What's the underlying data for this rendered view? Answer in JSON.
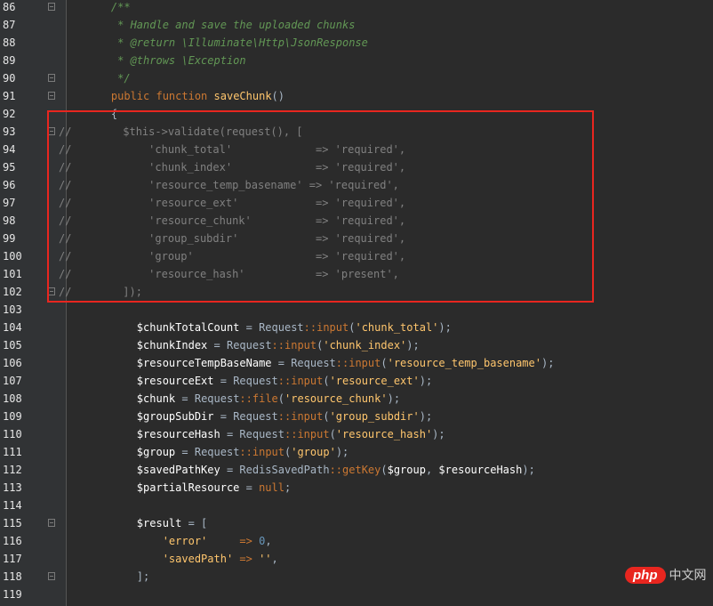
{
  "editor": {
    "lines": [
      {
        "num": "86",
        "fold": true,
        "tokens": [
          {
            "t": "    /**",
            "c": "doc"
          }
        ]
      },
      {
        "num": "87",
        "fold": false,
        "tokens": [
          {
            "t": "     * Handle and save the uploaded chunks",
            "c": "doc"
          }
        ]
      },
      {
        "num": "88",
        "fold": false,
        "tokens": [
          {
            "t": "     * @return \\Illuminate\\Http\\JsonResponse",
            "c": "doc"
          }
        ]
      },
      {
        "num": "89",
        "fold": false,
        "tokens": [
          {
            "t": "     * @throws \\Exception",
            "c": "doc"
          }
        ]
      },
      {
        "num": "90",
        "fold": true,
        "tokens": [
          {
            "t": "     */",
            "c": "doc"
          }
        ]
      },
      {
        "num": "91",
        "fold": true,
        "tokens": [
          {
            "t": "    public ",
            "c": "kw"
          },
          {
            "t": "function ",
            "c": "kw"
          },
          {
            "t": "saveChunk",
            "c": "fn"
          },
          {
            "t": "()",
            "c": "plain"
          }
        ]
      },
      {
        "num": "92",
        "fold": false,
        "tokens": [
          {
            "t": "    {",
            "c": "plain"
          }
        ]
      },
      {
        "num": "93",
        "fold": true,
        "comment": true,
        "tokens": [
          {
            "t": "//        $this->validate(request(), [",
            "c": "comment"
          }
        ]
      },
      {
        "num": "94",
        "fold": false,
        "comment": true,
        "tokens": [
          {
            "t": "//            'chunk_total'             => 'required',",
            "c": "comment"
          }
        ]
      },
      {
        "num": "95",
        "fold": false,
        "comment": true,
        "tokens": [
          {
            "t": "//            'chunk_index'             => 'required',",
            "c": "comment"
          }
        ]
      },
      {
        "num": "96",
        "fold": false,
        "comment": true,
        "tokens": [
          {
            "t": "//            'resource_temp_basename' => 'required',",
            "c": "comment"
          }
        ]
      },
      {
        "num": "97",
        "fold": false,
        "comment": true,
        "tokens": [
          {
            "t": "//            'resource_ext'            => 'required',",
            "c": "comment"
          }
        ]
      },
      {
        "num": "98",
        "fold": false,
        "comment": true,
        "tokens": [
          {
            "t": "//            'resource_chunk'          => 'required',",
            "c": "comment"
          }
        ]
      },
      {
        "num": "99",
        "fold": false,
        "comment": true,
        "tokens": [
          {
            "t": "//            'group_subdir'            => 'required',",
            "c": "comment"
          }
        ]
      },
      {
        "num": "100",
        "fold": false,
        "comment": true,
        "tokens": [
          {
            "t": "//            'group'                   => 'required',",
            "c": "comment"
          }
        ]
      },
      {
        "num": "101",
        "fold": false,
        "comment": true,
        "tokens": [
          {
            "t": "//            'resource_hash'           => 'present',",
            "c": "comment"
          }
        ]
      },
      {
        "num": "102",
        "fold": true,
        "comment": true,
        "tokens": [
          {
            "t": "//        ]);",
            "c": "comment"
          }
        ]
      },
      {
        "num": "103",
        "fold": false,
        "tokens": []
      },
      {
        "num": "104",
        "fold": false,
        "tokens": [
          {
            "t": "        $chunkTotalCount",
            "c": "var"
          },
          {
            "t": " = ",
            "c": "plain"
          },
          {
            "t": "Request",
            "c": "plain"
          },
          {
            "t": "::",
            "c": "op"
          },
          {
            "t": "input",
            "c": "kw"
          },
          {
            "t": "(",
            "c": "plain"
          },
          {
            "t": "'chunk_total'",
            "c": "fn"
          },
          {
            "t": ");",
            "c": "plain"
          }
        ]
      },
      {
        "num": "105",
        "fold": false,
        "tokens": [
          {
            "t": "        $chunkIndex",
            "c": "var"
          },
          {
            "t": " = ",
            "c": "plain"
          },
          {
            "t": "Request",
            "c": "plain"
          },
          {
            "t": "::",
            "c": "op"
          },
          {
            "t": "input",
            "c": "kw"
          },
          {
            "t": "(",
            "c": "plain"
          },
          {
            "t": "'chunk_index'",
            "c": "fn"
          },
          {
            "t": ");",
            "c": "plain"
          }
        ]
      },
      {
        "num": "106",
        "fold": false,
        "tokens": [
          {
            "t": "        $resourceTempBaseName",
            "c": "var"
          },
          {
            "t": " = ",
            "c": "plain"
          },
          {
            "t": "Request",
            "c": "plain"
          },
          {
            "t": "::",
            "c": "op"
          },
          {
            "t": "input",
            "c": "kw"
          },
          {
            "t": "(",
            "c": "plain"
          },
          {
            "t": "'resource_temp_basename'",
            "c": "fn"
          },
          {
            "t": ");",
            "c": "plain"
          }
        ]
      },
      {
        "num": "107",
        "fold": false,
        "tokens": [
          {
            "t": "        $resourceExt",
            "c": "var"
          },
          {
            "t": " = ",
            "c": "plain"
          },
          {
            "t": "Request",
            "c": "plain"
          },
          {
            "t": "::",
            "c": "op"
          },
          {
            "t": "input",
            "c": "kw"
          },
          {
            "t": "(",
            "c": "plain"
          },
          {
            "t": "'resource_ext'",
            "c": "fn"
          },
          {
            "t": ");",
            "c": "plain"
          }
        ]
      },
      {
        "num": "108",
        "fold": false,
        "tokens": [
          {
            "t": "        $chunk",
            "c": "var"
          },
          {
            "t": " = ",
            "c": "plain"
          },
          {
            "t": "Request",
            "c": "plain"
          },
          {
            "t": "::",
            "c": "op"
          },
          {
            "t": "file",
            "c": "kw"
          },
          {
            "t": "(",
            "c": "plain"
          },
          {
            "t": "'resource_chunk'",
            "c": "fn"
          },
          {
            "t": ");",
            "c": "plain"
          }
        ]
      },
      {
        "num": "109",
        "fold": false,
        "tokens": [
          {
            "t": "        $groupSubDir",
            "c": "var"
          },
          {
            "t": " = ",
            "c": "plain"
          },
          {
            "t": "Request",
            "c": "plain"
          },
          {
            "t": "::",
            "c": "op"
          },
          {
            "t": "input",
            "c": "kw"
          },
          {
            "t": "(",
            "c": "plain"
          },
          {
            "t": "'group_subdir'",
            "c": "fn"
          },
          {
            "t": ");",
            "c": "plain"
          }
        ]
      },
      {
        "num": "110",
        "fold": false,
        "tokens": [
          {
            "t": "        $resourceHash",
            "c": "var"
          },
          {
            "t": " = ",
            "c": "plain"
          },
          {
            "t": "Request",
            "c": "plain"
          },
          {
            "t": "::",
            "c": "op"
          },
          {
            "t": "input",
            "c": "kw"
          },
          {
            "t": "(",
            "c": "plain"
          },
          {
            "t": "'resource_hash'",
            "c": "fn"
          },
          {
            "t": ");",
            "c": "plain"
          }
        ]
      },
      {
        "num": "111",
        "fold": false,
        "tokens": [
          {
            "t": "        $group",
            "c": "var"
          },
          {
            "t": " = ",
            "c": "plain"
          },
          {
            "t": "Request",
            "c": "plain"
          },
          {
            "t": "::",
            "c": "op"
          },
          {
            "t": "input",
            "c": "kw"
          },
          {
            "t": "(",
            "c": "plain"
          },
          {
            "t": "'group'",
            "c": "fn"
          },
          {
            "t": ");",
            "c": "plain"
          }
        ]
      },
      {
        "num": "112",
        "fold": false,
        "tokens": [
          {
            "t": "        $savedPathKey",
            "c": "var"
          },
          {
            "t": " = ",
            "c": "plain"
          },
          {
            "t": "RedisSavedPath",
            "c": "plain"
          },
          {
            "t": "::",
            "c": "op"
          },
          {
            "t": "getKey",
            "c": "kw"
          },
          {
            "t": "(",
            "c": "plain"
          },
          {
            "t": "$group",
            "c": "var"
          },
          {
            "t": ", ",
            "c": "plain"
          },
          {
            "t": "$resourceHash",
            "c": "var"
          },
          {
            "t": ");",
            "c": "plain"
          }
        ]
      },
      {
        "num": "113",
        "fold": false,
        "tokens": [
          {
            "t": "        $partialResource",
            "c": "var"
          },
          {
            "t": " = ",
            "c": "plain"
          },
          {
            "t": "null",
            "c": "kw"
          },
          {
            "t": ";",
            "c": "plain"
          }
        ]
      },
      {
        "num": "114",
        "fold": false,
        "tokens": []
      },
      {
        "num": "115",
        "fold": true,
        "tokens": [
          {
            "t": "        $result",
            "c": "var"
          },
          {
            "t": " = [",
            "c": "plain"
          }
        ]
      },
      {
        "num": "116",
        "fold": false,
        "tokens": [
          {
            "t": "            'error'",
            "c": "fn"
          },
          {
            "t": "     => ",
            "c": "op"
          },
          {
            "t": "0",
            "c": "num"
          },
          {
            "t": ",",
            "c": "plain"
          }
        ]
      },
      {
        "num": "117",
        "fold": false,
        "tokens": [
          {
            "t": "            'savedPath'",
            "c": "fn"
          },
          {
            "t": " => ",
            "c": "op"
          },
          {
            "t": "''",
            "c": "fn"
          },
          {
            "t": ",",
            "c": "plain"
          }
        ]
      },
      {
        "num": "118",
        "fold": true,
        "tokens": [
          {
            "t": "        ];",
            "c": "plain"
          }
        ]
      },
      {
        "num": "119",
        "fold": false,
        "tokens": []
      }
    ]
  },
  "watermark": {
    "logo": "php",
    "text": "中文网"
  }
}
